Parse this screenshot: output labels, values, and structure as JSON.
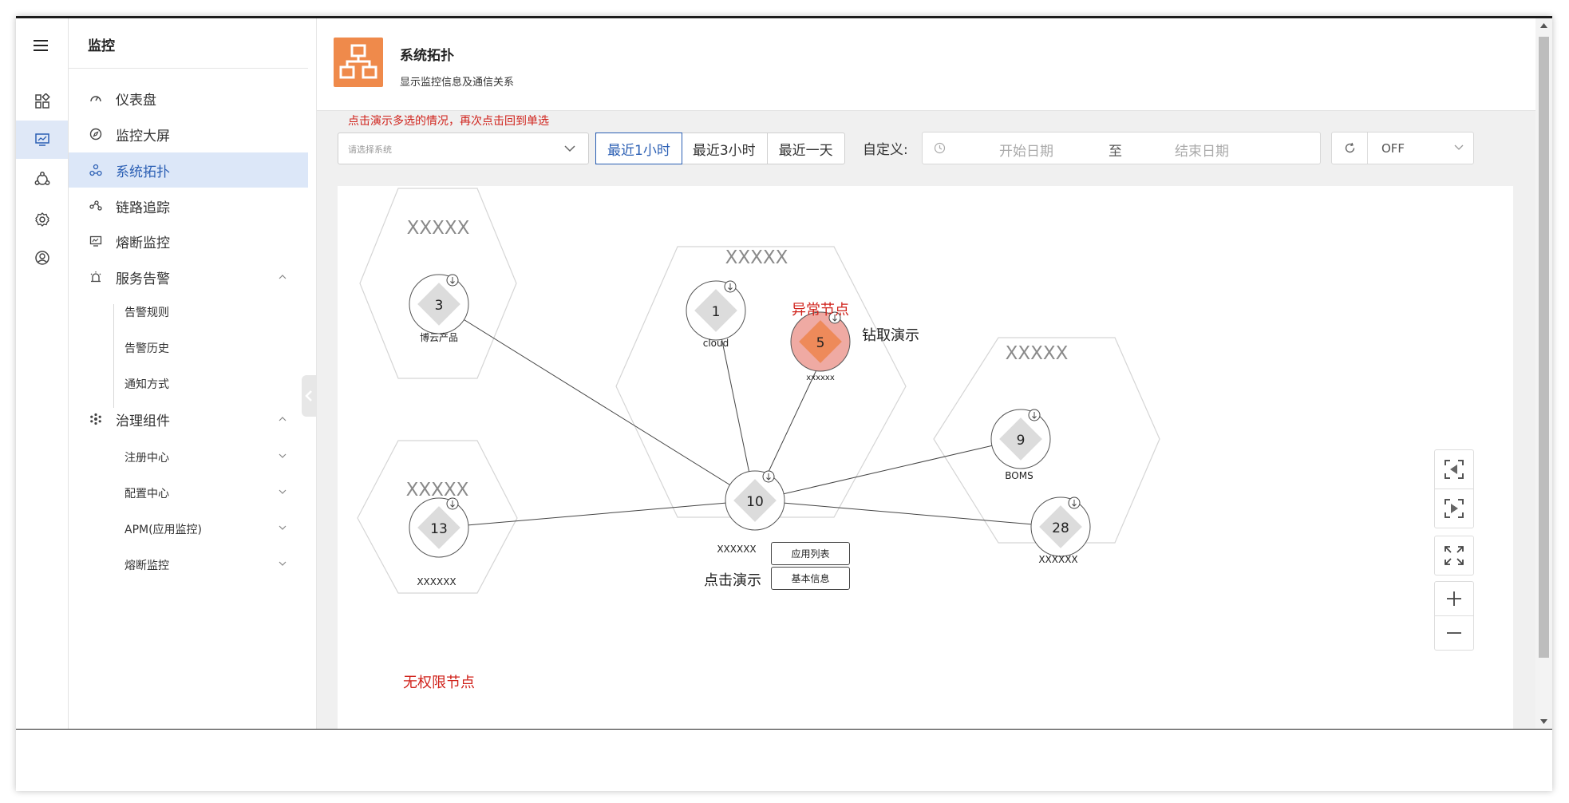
{
  "sidebar": {
    "title": "监控",
    "items": [
      {
        "label": "仪表盘",
        "icon": "gauge-icon"
      },
      {
        "label": "监控大屏",
        "icon": "compass-icon"
      },
      {
        "label": "系统拓扑",
        "icon": "topology-icon"
      },
      {
        "label": "链路追踪",
        "icon": "trace-icon"
      },
      {
        "label": "熔断监控",
        "icon": "monitor-icon"
      },
      {
        "label": "服务告警",
        "icon": "alarm-icon"
      },
      {
        "label": "治理组件",
        "icon": "components-icon"
      }
    ],
    "alert_sub": [
      "告警规则",
      "告警历史",
      "通知方式"
    ],
    "gov_sub": [
      "注册中心",
      "配置中心",
      "APM(应用监控)",
      "熔断监控"
    ]
  },
  "rail": [
    "dashboard-icon",
    "screen-monitor-icon",
    "topology-icon",
    "gear-icon",
    "user-icon"
  ],
  "header": {
    "title": "系统拓扑",
    "subtitle": "显示监控信息及通信关系"
  },
  "toolbar": {
    "hint": "点击演示多选的情况，再次点击回到单选",
    "select_placeholder": "请选择系统",
    "time_buttons": [
      "最近1小时",
      "最近3小时",
      "最近一天"
    ],
    "active_time": "最近1小时",
    "custom_label": "自定义:",
    "start_placeholder": "开始日期",
    "range_sep": "至",
    "end_placeholder": "结束日期",
    "refresh_value": "OFF"
  },
  "topology": {
    "groups": [
      {
        "id": "g1",
        "label": "XXXXX"
      },
      {
        "id": "g2",
        "label": "XXXXX"
      },
      {
        "id": "g3",
        "label": "XXXXX"
      },
      {
        "id": "g4",
        "label": "XXXXX"
      }
    ],
    "nodes": [
      {
        "id": "3",
        "value": "3",
        "label": "博云产品",
        "abnormal": false
      },
      {
        "id": "1",
        "value": "1",
        "label": "cloud",
        "abnormal": false
      },
      {
        "id": "5",
        "value": "5",
        "label": "xxxxxx",
        "abnormal": true
      },
      {
        "id": "10",
        "value": "10",
        "label": "XXXXXX",
        "abnormal": false
      },
      {
        "id": "9",
        "value": "9",
        "label": "BOMS",
        "abnormal": false
      },
      {
        "id": "28",
        "value": "28",
        "label": "XXXXXX",
        "abnormal": false
      },
      {
        "id": "13",
        "value": "13",
        "label": "XXXXXX",
        "abnormal": false
      }
    ],
    "edges": [
      [
        "3",
        "10"
      ],
      [
        "1",
        "10"
      ],
      [
        "5",
        "10"
      ],
      [
        "13",
        "10"
      ],
      [
        "9",
        "10"
      ],
      [
        "28",
        "10"
      ]
    ],
    "annotations": {
      "abnormal_node": "异常节点",
      "drill_demo": "钻取演示",
      "click_demo": "点击演示",
      "no_permission": "无权限节点"
    },
    "popup_buttons": [
      "应用列表",
      "基本信息"
    ],
    "colors": {
      "abnormal_fill": "#efaaa3",
      "abnormal_diamond": "#ee8a5a",
      "annotation_red": "#d0221b",
      "diamond": "#dcdcdc"
    }
  },
  "controls": [
    "collapse-left-icon",
    "expand-right-icon",
    "fullscreen-icon",
    "zoom-in-icon",
    "zoom-out-icon"
  ]
}
